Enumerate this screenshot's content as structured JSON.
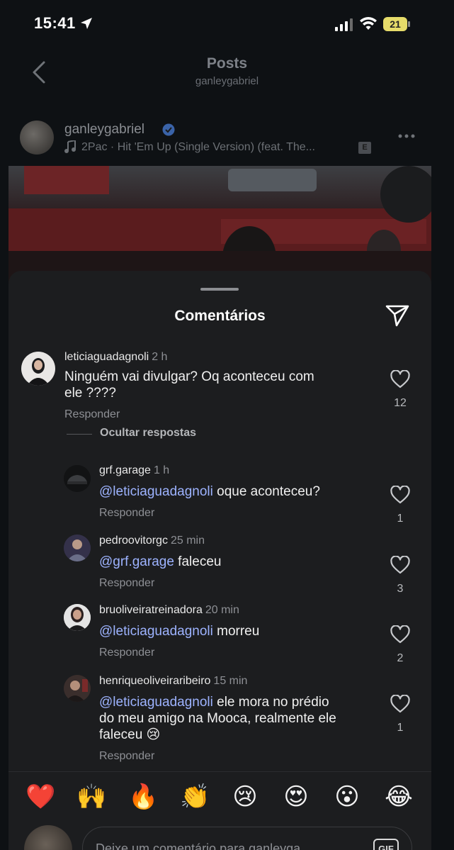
{
  "status_bar": {
    "time": "15:41",
    "battery": "21"
  },
  "header": {
    "title": "Posts",
    "subtitle": "ganleygabriel"
  },
  "post": {
    "username": "ganleygabriel",
    "song": "2Pac · Hit 'Em Up (Single Version) (feat. The...",
    "explicit": "E"
  },
  "sheet": {
    "title": "Comentários"
  },
  "comments": [
    {
      "username": "leticiaguadagnoli",
      "time": "2 h",
      "text_line1": "Ninguém vai divulgar? Oq aconteceu com",
      "text_line2": "ele ????",
      "reply": "Responder",
      "likes": "12"
    }
  ],
  "hide_replies": "Ocultar respostas",
  "replies": [
    {
      "username": "grf.garage",
      "time": "1 h",
      "mention": "@leticiaguadagnoli",
      "text": " oque aconteceu?",
      "reply": "Responder",
      "likes": "1"
    },
    {
      "username": "pedroovitorgc",
      "time": "25 min",
      "mention": "@grf.garage",
      "text": " faleceu",
      "reply": "Responder",
      "likes": "3"
    },
    {
      "username": "bruoliveiratreinadora",
      "time": "20 min",
      "mention": "@leticiaguadagnoli",
      "text": " morreu",
      "reply": "Responder",
      "likes": "2"
    },
    {
      "username": "henriqueoliveiraribeiro",
      "time": "15 min",
      "mention": "@leticiaguadagnoli",
      "text": " ele mora no prédio",
      "text_line2": "do meu amigo na Mooca, realmente ele",
      "text_line3": "faleceu 😢",
      "reply": "Responder",
      "likes": "1"
    }
  ],
  "emojis": [
    "❤️",
    "🙌",
    "🔥",
    "👏",
    "😢",
    "😍",
    "😮",
    "😂"
  ],
  "compose": {
    "placeholder": "Deixe um comentário para ganleyga...",
    "gif_label": "GIF"
  }
}
